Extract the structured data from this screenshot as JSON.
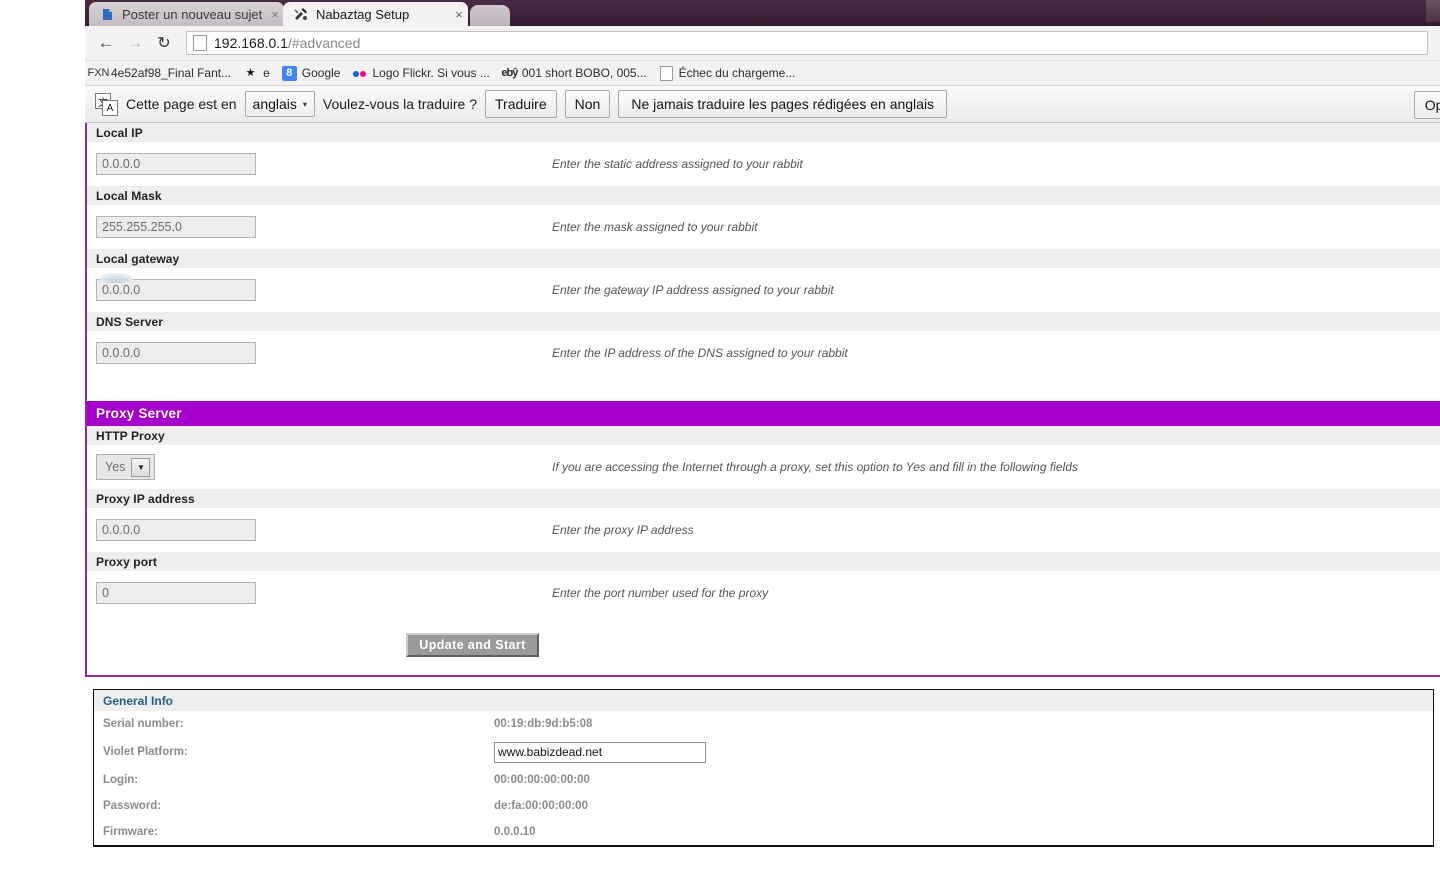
{
  "browser": {
    "tabs": [
      {
        "title": "Poster un nouveau sujet",
        "icon": "blue-page-icon",
        "close": "×",
        "active": false
      },
      {
        "title": "Nabaztag Setup",
        "icon": "tools-icon",
        "close": "×",
        "active": true
      }
    ],
    "nav": {
      "back": "←",
      "forward": "→",
      "reload": "↻"
    },
    "omnibox": {
      "url_main": "192.168.0.1",
      "url_rest": "/#advanced",
      "page_icon": "document-icon"
    },
    "bookmarks": [
      {
        "icon": "fxn-icon",
        "icon_text": "FXN",
        "label": "4e52af98_Final Fant..."
      },
      {
        "icon": "star-icon",
        "icon_text": "★",
        "label": "e"
      },
      {
        "icon": "google-icon",
        "icon_text": "8",
        "label": "Google"
      },
      {
        "icon": "flickr-icon",
        "icon_text": "",
        "label": "Logo Flickr. Si vous ..."
      },
      {
        "icon": "ebay-icon",
        "icon_text": "ebŷ",
        "label": "001 short BOBO, 005..."
      },
      {
        "icon": "document-icon",
        "icon_text": "",
        "label": "Échec du chargeme..."
      }
    ],
    "translate_bar": {
      "icon": "translate-icon",
      "icon_glyph_top": "文",
      "icon_glyph_bottom": "A",
      "prompt": "Cette page est en",
      "language": "anglais",
      "caret": "▾",
      "question": "Voulez-vous la traduire ?",
      "translate_button": "Traduire",
      "no_button": "Non",
      "never_button": "Ne jamais traduire les pages rédigées en anglais",
      "options_button": "Options"
    }
  },
  "page": {
    "network_fields": [
      {
        "label": "Local IP",
        "value": "0.0.0.0",
        "hint": "Enter the static address assigned to your rabbit"
      },
      {
        "label": "Local Mask",
        "value": "255.255.255.0",
        "hint": "Enter the mask assigned to your rabbit"
      },
      {
        "label": "Local gateway",
        "value": "0.0.0.0",
        "hint": "Enter the gateway IP address assigned to your rabbit"
      },
      {
        "label": "DNS Server",
        "value": "0.0.0.0",
        "hint": "Enter the IP address of the DNS assigned to your rabbit"
      }
    ],
    "proxy_section": {
      "title": "Proxy Server",
      "accent_color": "#a800cc",
      "http_proxy": {
        "label": "HTTP Proxy",
        "selected": "Yes",
        "caret": "▼",
        "hint": "If you are accessing the Internet through a proxy, set this option to Yes and fill in the following fields"
      },
      "proxy_ip": {
        "label": "Proxy IP address",
        "value": "0.0.0.0",
        "hint": "Enter the proxy IP address"
      },
      "proxy_port": {
        "label": "Proxy port",
        "value": "0",
        "hint": "Enter the port number used for the proxy"
      }
    },
    "submit_button": "Update and Start",
    "general_info": {
      "title": "General Info",
      "rows": [
        {
          "key": "Serial number:",
          "value": "00:19:db:9d:b5:08"
        },
        {
          "key": "Violet Platform:",
          "value": "www.babizdead.net",
          "is_input": true
        },
        {
          "key": "Login:",
          "value": "00:00:00:00:00:00"
        },
        {
          "key": "Password:",
          "value": "de:fa:00:00:00:00"
        },
        {
          "key": "Firmware:",
          "value": "0.0.0.10"
        }
      ]
    }
  }
}
